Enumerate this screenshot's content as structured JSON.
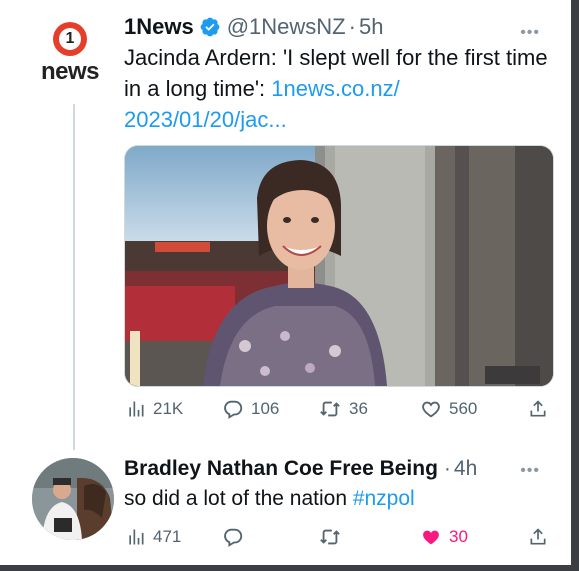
{
  "tweet": {
    "display_name": "1News",
    "handle": "@1NewsNZ",
    "separator": "·",
    "time": "5h",
    "avatar_wordmark": "news",
    "avatar_numeral": "1",
    "text_before_link": "Jacinda Ardern: 'I slept well for the first time in a long time': ",
    "link_text": "1news.co.nz/\n2023/01/20/jac...",
    "link_line1": "1news.co.nz/",
    "link_line2": "2023/01/20/jac...",
    "stats": {
      "views": "21K",
      "replies": "106",
      "retweets": "36",
      "likes": "560"
    }
  },
  "reply": {
    "display_name": "Bradley Nathan Coe Free Being",
    "separator": "·",
    "time": "4h",
    "text": "so did a lot of the nation ",
    "hashtag": "#nzpol",
    "stats": {
      "views": "471",
      "likes": "30"
    }
  },
  "colors": {
    "accent_link": "#1d9bf0",
    "liked_pink": "#f91880",
    "verified_blue": "#1d9bf0",
    "text_primary": "#0f1419",
    "text_secondary": "#536471"
  },
  "icons": {
    "views": "bar-chart-icon",
    "reply": "speech-bubble-icon",
    "retweet": "retweet-arrows-icon",
    "like": "heart-icon",
    "share": "share-upload-icon",
    "more": "more-dots-icon",
    "verified": "verified-badge-icon"
  }
}
